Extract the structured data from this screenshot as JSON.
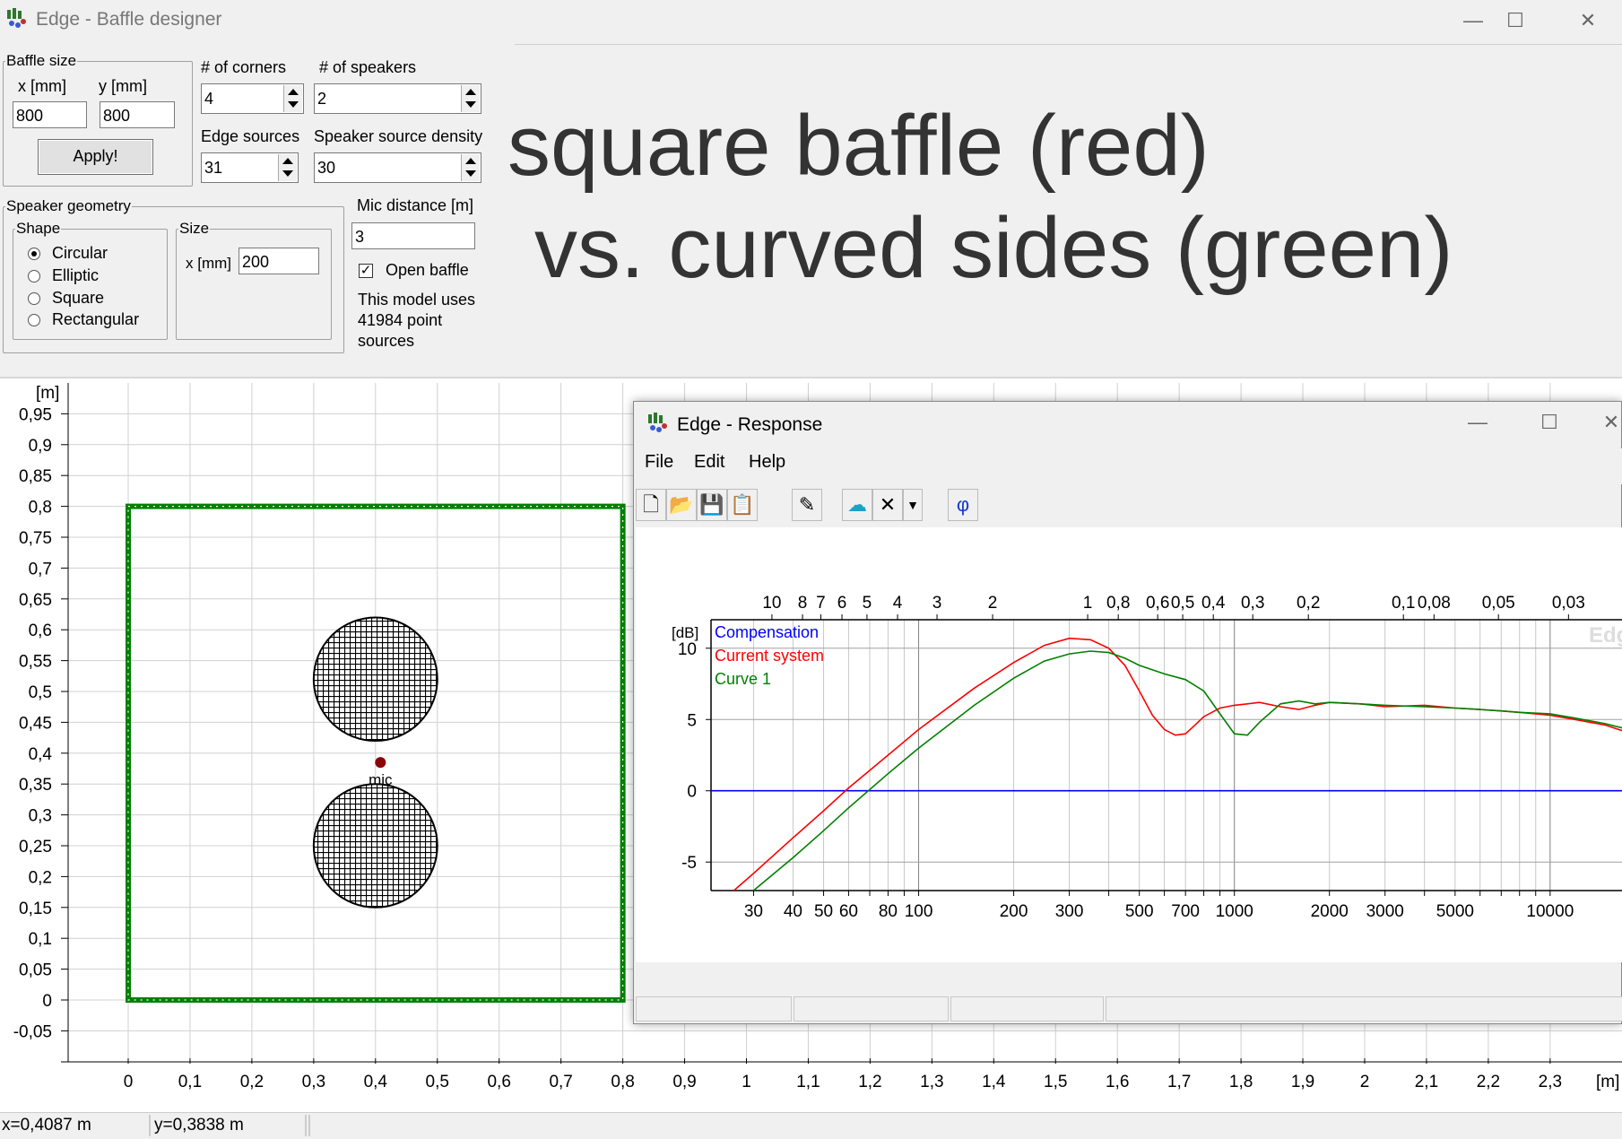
{
  "window": {
    "title": "Edge - Baffle designer",
    "minimize": "—",
    "maximize": "☐",
    "close": "✕"
  },
  "baffle_size": {
    "legend": "Baffle size",
    "x_label": "x [mm]",
    "y_label": "y [mm]",
    "x_value": "800",
    "y_value": "800",
    "apply_label": "Apply!"
  },
  "corners": {
    "label": "# of corners",
    "value": "4"
  },
  "speakers": {
    "label": "# of speakers",
    "value": "2"
  },
  "edge_sources": {
    "label": "Edge sources",
    "value": "31"
  },
  "speaker_density": {
    "label": "Speaker source density",
    "value": "30"
  },
  "speaker_geometry": {
    "legend": "Speaker geometry",
    "shape_legend": "Shape",
    "shapes": [
      "Circular",
      "Elliptic",
      "Square",
      "Rectangular"
    ],
    "selected_shape": "Circular",
    "size_legend": "Size",
    "x_label": "x [mm]",
    "x_value": "200"
  },
  "mic": {
    "label": "Mic distance [m]",
    "value": "3",
    "open_baffle_label": "Open baffle",
    "open_baffle_checked": true,
    "model_info": "This model uses 41984 point sources"
  },
  "overlay": {
    "line1": "square baffle (red)",
    "line2": "vs. curved sides (green)"
  },
  "geometry_plot": {
    "y_unit": "[m]",
    "x_unit": "[m]",
    "y_ticks": [
      "0,95",
      "0,9",
      "0,85",
      "0,8",
      "0,75",
      "0,7",
      "0,65",
      "0,6",
      "0,55",
      "0,5",
      "0,45",
      "0,4",
      "0,35",
      "0,3",
      "0,25",
      "0,2",
      "0,15",
      "0,1",
      "0,05",
      "0",
      "-0,05"
    ],
    "x_ticks": [
      "0",
      "0,1",
      "0,2",
      "0,3",
      "0,4",
      "0,5",
      "0,6",
      "0,7",
      "0,8",
      "0,9",
      "1",
      "1,1",
      "1,2",
      "1,3",
      "1,4",
      "1,5",
      "1,6",
      "1,7",
      "1,8",
      "1,9",
      "2",
      "2,1",
      "2,2",
      "2,3"
    ],
    "mic_label": "mic",
    "baffle_color": "#008000",
    "speaker_color": "#000000",
    "mic_color": "#8b0000"
  },
  "status": {
    "x": "x=0,4087 m",
    "y": "y=0,3838 m"
  },
  "response": {
    "title": "Edge - Response",
    "menu": [
      "File",
      "Edit",
      "Help"
    ],
    "tools": [
      "new-icon",
      "open-icon",
      "save-icon",
      "copy-icon",
      "pen-icon",
      "cloud-icon",
      "delete-icon",
      "dropdown-icon",
      "phase-icon"
    ],
    "phase_glyph": "φ",
    "watermark": "Edg"
  },
  "chart_data": {
    "type": "line",
    "title": "",
    "ylabel": "[dB]",
    "xlabel": "",
    "x_scale": "log",
    "xlim": [
      22,
      17000
    ],
    "ylim": [
      -7,
      12
    ],
    "x_tick_labels": [
      "30",
      "40",
      "50",
      "60",
      "80",
      "100",
      "200",
      "300",
      "500",
      "700",
      "1000",
      "2000",
      "3000",
      "5000",
      "10000"
    ],
    "top_tick_labels": [
      "10",
      "8",
      "7",
      "6",
      "5",
      "4",
      "3",
      "2",
      "1",
      "0,8",
      "0,6",
      "0,5",
      "0,4",
      "0,3",
      "0,2",
      "0,1",
      "0,08",
      "0,05",
      "0,03"
    ],
    "y_tick_labels": [
      "10",
      "5",
      "0",
      "-5"
    ],
    "grid": true,
    "legend_placement": "top-left",
    "series": [
      {
        "name": "Compensation",
        "color": "#0000ff",
        "x": [
          22,
          17000
        ],
        "y": [
          0,
          0
        ]
      },
      {
        "name": "Current system",
        "color": "#ff0000",
        "x": [
          26,
          30,
          40,
          50,
          60,
          80,
          100,
          150,
          200,
          250,
          300,
          350,
          400,
          450,
          500,
          550,
          600,
          650,
          700,
          750,
          800,
          900,
          1000,
          1100,
          1200,
          1400,
          1600,
          1800,
          2000,
          2500,
          3000,
          4000,
          5000,
          6000,
          7000,
          8000,
          10000,
          12000,
          15000,
          17000
        ],
        "y": [
          -7,
          -5.8,
          -3.3,
          -1.4,
          0.2,
          2.5,
          4.3,
          7.2,
          9.0,
          10.2,
          10.7,
          10.6,
          10.0,
          8.8,
          7.0,
          5.3,
          4.3,
          3.9,
          4.0,
          4.6,
          5.2,
          5.8,
          6.0,
          6.1,
          6.2,
          5.9,
          5.7,
          6.0,
          6.2,
          6.1,
          5.9,
          6.0,
          5.8,
          5.7,
          5.6,
          5.5,
          5.3,
          5.0,
          4.6,
          4.2
        ]
      },
      {
        "name": "Curve 1",
        "color": "#008000",
        "x": [
          30,
          40,
          50,
          60,
          80,
          100,
          150,
          200,
          250,
          300,
          350,
          400,
          450,
          500,
          600,
          700,
          800,
          900,
          1000,
          1100,
          1200,
          1400,
          1600,
          1800,
          2000,
          2500,
          3000,
          4000,
          5000,
          6000,
          7000,
          8000,
          10000,
          12000,
          15000,
          17000
        ],
        "y": [
          -7,
          -4.7,
          -2.8,
          -1.2,
          1.2,
          3.0,
          6.0,
          7.9,
          9.1,
          9.6,
          9.8,
          9.7,
          9.3,
          8.8,
          8.2,
          7.8,
          7.0,
          5.4,
          4.0,
          3.9,
          4.8,
          6.1,
          6.3,
          6.1,
          6.2,
          6.1,
          6.0,
          5.9,
          5.8,
          5.7,
          5.6,
          5.5,
          5.4,
          5.1,
          4.7,
          4.4
        ]
      }
    ]
  }
}
